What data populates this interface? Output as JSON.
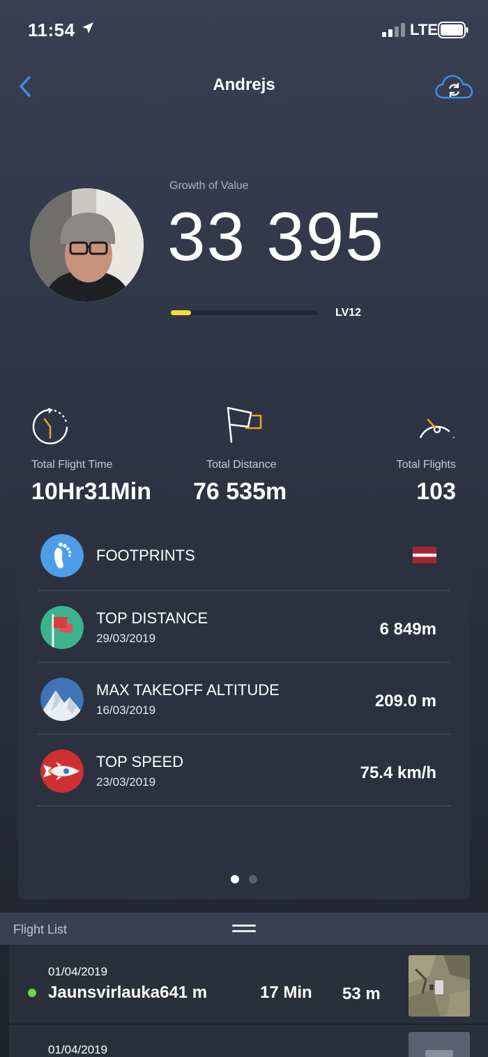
{
  "status_bar": {
    "time": "11:54",
    "carrier": "LTE"
  },
  "nav": {
    "title": "Andrejs"
  },
  "profile": {
    "growth_label": "Growth of Value",
    "growth_value": "33 395",
    "level_label": "LV12",
    "level_progress": 0.14,
    "level_color": "#f4df3a"
  },
  "stats": [
    {
      "icon": "stopwatch-icon",
      "label": "Total Flight Time",
      "value": "10Hr31Min"
    },
    {
      "icon": "flag-icon",
      "label": "Total Distance",
      "value": "76 535m"
    },
    {
      "icon": "speedometer-icon",
      "label": "Total Flights",
      "value": "103"
    }
  ],
  "records": {
    "footprints": {
      "title": "FOOTPRINTS",
      "icon": "footprint-icon",
      "flag": "latvia-flag-icon"
    },
    "items": [
      {
        "title": "TOP DISTANCE",
        "date": "29/03/2019",
        "value": "6 849m",
        "icon": "red-flag-icon"
      },
      {
        "title": "MAX TAKEOFF ALTITUDE",
        "date": "16/03/2019",
        "value": "209.0 m",
        "icon": "mountain-icon"
      },
      {
        "title": "TOP SPEED",
        "date": "23/03/2019",
        "value": "75.4 km/h",
        "icon": "rocket-icon"
      }
    ],
    "page_index": 1,
    "page_count": 2
  },
  "flight_list": {
    "title": "Flight List",
    "rows": [
      {
        "date": "01/04/2019",
        "name": "Jaunsvirlauka641 m",
        "duration": "17 Min",
        "height": "53 m",
        "status_color": "#7ed140"
      },
      {
        "date": "01/04/2019"
      }
    ]
  },
  "colors": {
    "accent_blue": "#3d8ef0",
    "gold": "#e8a524",
    "status_green": "#7ed140"
  }
}
